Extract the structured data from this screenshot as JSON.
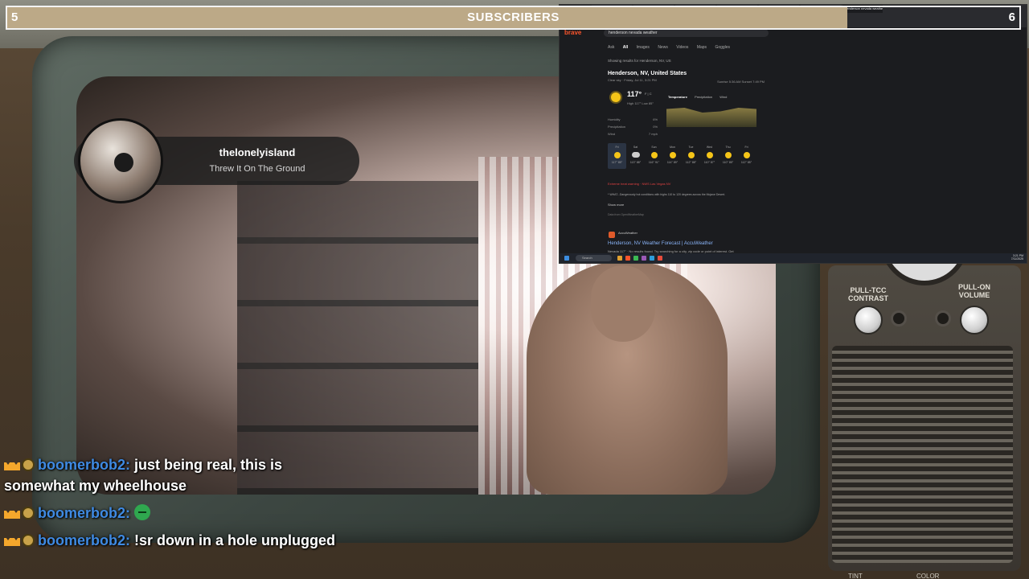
{
  "subscribers": {
    "title": "SUBSCRIBERS",
    "current": "5",
    "goal": "6",
    "progress": 0.83,
    "fill_color": "#bca987"
  },
  "now_playing": {
    "artist": "thelonelyisland",
    "track": "Threw It On The Ground"
  },
  "chat": [
    {
      "badges": [
        "crown-icon",
        "coin-icon"
      ],
      "user": "boomerbob2:",
      "text": " just being real, this is somewhat my wheelhouse",
      "emote": null
    },
    {
      "badges": [
        "crown-icon",
        "coin-icon"
      ],
      "user": "boomerbob2:",
      "text": "",
      "emote": "green-smile-emote"
    },
    {
      "badges": [
        "crown-icon",
        "coin-icon"
      ],
      "user": "boomerbob2:",
      "text": " !sr down in a hole unplugged",
      "emote": null
    }
  ],
  "colors": {
    "chat_user": "#3f8ae2",
    "accent": "#fb542b"
  },
  "tv": {
    "contrast_label": "PULL-TCC CONTRAST",
    "volume_label": "PULL-ON VOLUME",
    "tint_label": "TINT",
    "color_label": "COLOR"
  },
  "browser": {
    "logo": "brave",
    "search_query": "henderson nevada weather",
    "nav": [
      "Ask",
      "All",
      "Images",
      "News",
      "Videos",
      "Maps",
      "Goggles"
    ],
    "active_nav": "All",
    "results_note": "Showing results for Henderson, NV, US",
    "weather": {
      "location": "Henderson, NV, United States",
      "condition": "Clear sky · Friday, Jul 11, 3:21 PM",
      "sunrise_sunset": "Sunrise 5:36 AM  Sunset 7:49 PM",
      "temp": "117°",
      "unit": "F | C",
      "hilo": "High 117°  Low 85°",
      "tabs": [
        "Temperature",
        "Precipitation",
        "Wind"
      ],
      "stats": [
        {
          "label": "Humidity",
          "value": "6%"
        },
        {
          "label": "Precipitation",
          "value": "0%"
        },
        {
          "label": "Wind",
          "value": "7 mph"
        }
      ],
      "days": [
        {
          "name": "Fri",
          "temps": "117° 85°",
          "icon": "sun"
        },
        {
          "name": "Sat",
          "temps": "113° 88°",
          "icon": "cloud"
        },
        {
          "name": "Sun",
          "temps": "116° 91°",
          "icon": "sun"
        },
        {
          "name": "Mon",
          "temps": "114° 89°",
          "icon": "sun"
        },
        {
          "name": "Tue",
          "temps": "112° 88°",
          "icon": "sun"
        },
        {
          "name": "Wed",
          "temps": "110° 87°",
          "icon": "sun"
        },
        {
          "name": "Thu",
          "temps": "110° 85°",
          "icon": "sun"
        },
        {
          "name": "Fri",
          "temps": "112° 85°",
          "icon": "sun"
        }
      ],
      "alert_title": "Extreme heat warning · NWS Las Vegas NV",
      "alert_text": "* WHAT...Dangerously hot conditions with highs 110 to 120 degrees across the Mojave Desert.",
      "show_more": "Show more",
      "source": "Data from OpenWeatherMap"
    },
    "result": {
      "site": "AccuWeather",
      "title": "Henderson, NV Weather Forecast | AccuWeather",
      "desc": "Nevada 117° · No results found. Try searching for a city, zip code or point of interest. Get"
    },
    "taskbar": {
      "search": "Search",
      "time": "3:21 PM",
      "date": "7/11/2025"
    }
  }
}
